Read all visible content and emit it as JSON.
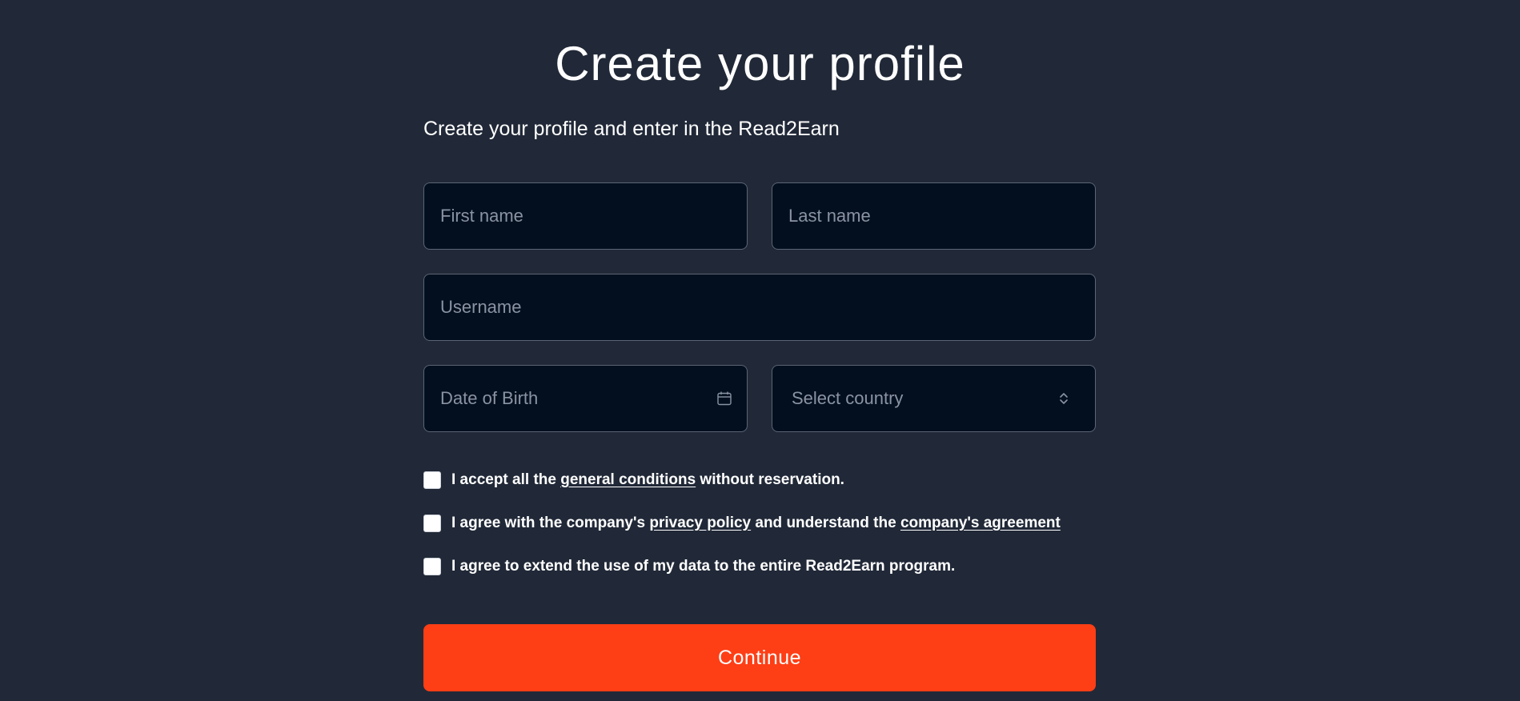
{
  "header": {
    "title": "Create your profile",
    "subtitle": "Create your profile and enter in the Read2Earn"
  },
  "form": {
    "first_name": {
      "placeholder": "First name",
      "value": ""
    },
    "last_name": {
      "placeholder": "Last name",
      "value": ""
    },
    "username": {
      "placeholder": "Username",
      "value": ""
    },
    "date_of_birth": {
      "placeholder": "Date of Birth",
      "value": "",
      "icon": "calendar-icon"
    },
    "country": {
      "placeholder": "Select country",
      "icon": "chevron-up-down-icon"
    }
  },
  "agreements": {
    "general": {
      "checked": false,
      "prefix": "I accept all the ",
      "link": "general conditions",
      "suffix": " without reservation."
    },
    "privacy": {
      "checked": false,
      "prefix": "I agree with the company's ",
      "link1": "privacy policy",
      "middle": " and understand the ",
      "link2": "company's agreement"
    },
    "data": {
      "checked": false,
      "text": "I agree to extend the use of my data to the entire Read2Earn program."
    }
  },
  "actions": {
    "continue_label": "Continue"
  },
  "colors": {
    "background": "#212938",
    "field_background": "#030f1e",
    "field_border": "#5b6475",
    "placeholder": "#8a93a3",
    "accent": "#fe3e15"
  }
}
